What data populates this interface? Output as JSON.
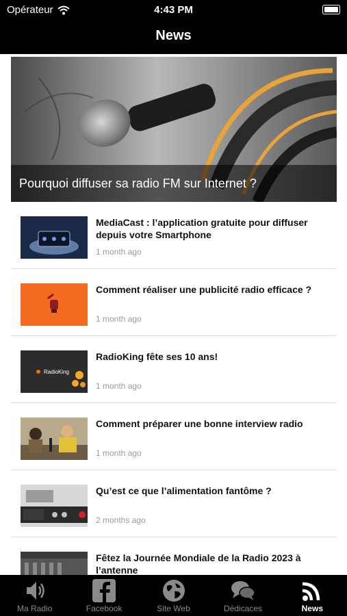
{
  "status_bar": {
    "carrier": "Opérateur",
    "time": "4:43 PM"
  },
  "header": {
    "title": "News"
  },
  "featured": {
    "title": "Pourquoi diffuser sa radio FM sur Internet ?"
  },
  "articles": [
    {
      "title": "MediaCast : l’application gratuite pour diffuser depuis votre Smartphone",
      "ago": "1 month ago"
    },
    {
      "title": "Comment réaliser une publicité radio efficace ?",
      "ago": "1 month ago"
    },
    {
      "title": "RadioKing fête ses 10 ans!",
      "ago": "1 month ago",
      "thumb_text": "RadioKing"
    },
    {
      "title": "Comment préparer une bonne interview radio",
      "ago": "1 month ago"
    },
    {
      "title": "Qu’est ce que l’alimentation fantôme ?",
      "ago": "2 months ago"
    },
    {
      "title": "Fêtez la Journée Mondiale de la Radio 2023 à l’antenne",
      "ago": ""
    }
  ],
  "tabs": [
    {
      "label": "Ma Radio",
      "icon": "speaker-icon",
      "active": false
    },
    {
      "label": "Facebook",
      "icon": "facebook-icon",
      "active": false
    },
    {
      "label": "Site Web",
      "icon": "globe-icon",
      "active": false
    },
    {
      "label": "Dédicaces",
      "icon": "chat-bubbles-icon",
      "active": false
    },
    {
      "label": "News",
      "icon": "rss-icon",
      "active": true
    }
  ],
  "colors": {
    "bar": "#000000",
    "accent_orange": "#f26b21",
    "inactive_tab": "#8a8a8a"
  }
}
